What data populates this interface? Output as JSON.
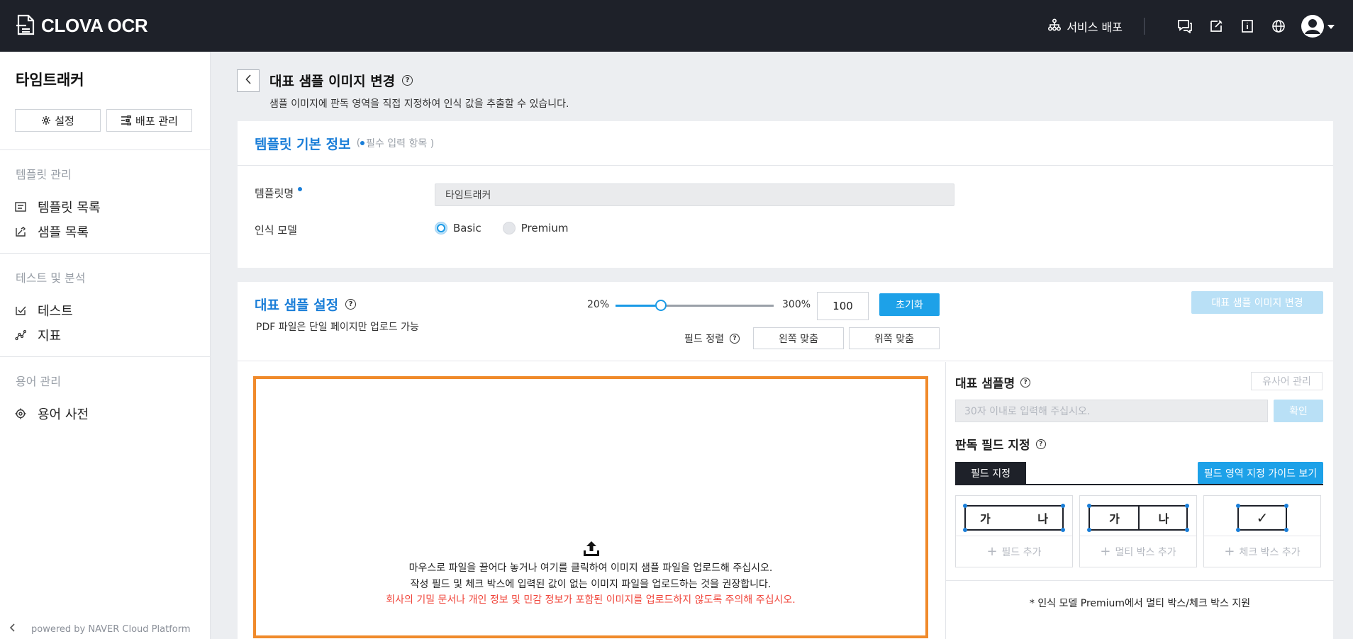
{
  "app": {
    "logo_text": "CLOVA OCR"
  },
  "topbar": {
    "deploy_label": "서비스 배포",
    "icons": [
      "chat-icon",
      "edit-icon",
      "info-panel-icon",
      "globe-icon",
      "user-avatar-icon"
    ]
  },
  "sidebar": {
    "title": "타임트래커",
    "settings_btn": "설정",
    "deploy_btn": "배포 관리",
    "sections": [
      {
        "label": "템플릿 관리",
        "items": [
          {
            "label": "템플릿 목록",
            "icon": "list-icon"
          },
          {
            "label": "샘플 목록",
            "icon": "image-edit-icon"
          }
        ]
      },
      {
        "label": "테스트 및 분석",
        "items": [
          {
            "label": "테스트",
            "icon": "check-doc-icon"
          },
          {
            "label": "지표",
            "icon": "graph-icon"
          }
        ]
      },
      {
        "label": "용어 관리",
        "items": [
          {
            "label": "용어 사전",
            "icon": "target-icon"
          }
        ]
      }
    ],
    "footer": "powered by NAVER Cloud Platform"
  },
  "page": {
    "title": "대표 샘플 이미지 변경",
    "description": "샘플 이미지에 판독 영역을 직접 지정하여 인식 값을 추출할 수 있습니다."
  },
  "template_info": {
    "title": "템플릿 기본 정보",
    "required_note_open": "(",
    "required_note": "필수 입력 항목 )",
    "name_label": "템플릿명",
    "name_value": "타임트래커",
    "model_label": "인식 모델",
    "model_options": [
      "Basic",
      "Premium"
    ],
    "model_selected": "Basic"
  },
  "sample_settings": {
    "title": "대표 샘플 설정",
    "subtitle": "PDF 파일은 단일 페이지만 업로드 가능",
    "zoom_min": "20%",
    "zoom_max": "300%",
    "zoom_value": "100",
    "zoom_fraction": 0.286,
    "reset_btn": "초기화",
    "change_image_btn": "대표 샘플 이미지 변경",
    "align_label": "필드 정렬",
    "align_left_btn": "왼쪽 맞춤",
    "align_top_btn": "위쪽 맞춤"
  },
  "dropzone": {
    "line1": "마우스로 파일을 끌어다 놓거나 여기를 클릭하여 이미지 샘플 파일을 업로드해 주십시오.",
    "line2": "작성 필드 및 체크 박스에 입력된 값이 없는 이미지 파일을 업로드하는 것을 권장합니다.",
    "warning": "회사의 기밀 문서나 개인 정보 및 민감 정보가 포함된 이미지를 업로드하지 않도록 주의해 주십시오.",
    "warning_color": "#f0443a",
    "border_color": "#f08a2b"
  },
  "right_panel": {
    "sample_name_title": "대표 샘플명",
    "similar_btn": "유사어 관리",
    "name_placeholder": "30자 이내로 입력해 주십시오.",
    "confirm_btn": "확인",
    "field_title": "판독 필드 지정",
    "tab_label": "필드 지정",
    "guide_btn": "필드 영역 지정 가이드 보기",
    "cards": [
      {
        "sample_a": "가",
        "sample_b": "나",
        "add_label": "필드 추가"
      },
      {
        "sample_a": "가",
        "sample_b": "나",
        "add_label": "멀티 박스 추가"
      },
      {
        "sample_check": "✓",
        "add_label": "체크 박스 추가"
      }
    ],
    "note": "* 인식 모델 Premium에서 멀티 박스/체크 박스 지원"
  },
  "colors": {
    "accent": "#1da1e8",
    "title_blue": "#1a7ed8",
    "topbar": "#1e2129"
  }
}
